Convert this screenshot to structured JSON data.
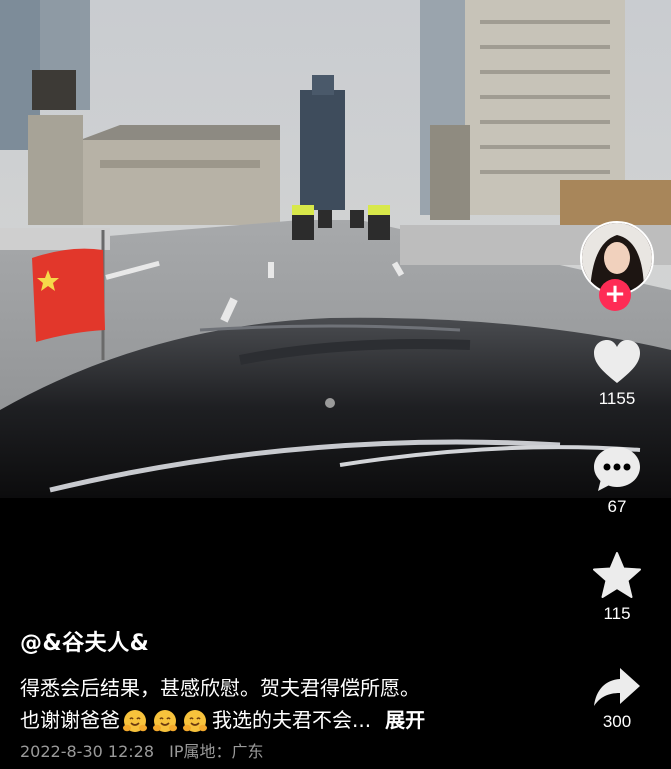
{
  "post": {
    "author": "@&谷夫人&",
    "caption_line1": "得悉会后结果，甚感欣慰。贺夫君得偿所愿。",
    "caption_line2_prefix": "也谢谢爸爸",
    "caption_line2_suffix": "我选的夫君不会...",
    "expand_label": "展开",
    "date": "2022-8-30 12:28",
    "ip_location": "IP属地：广东",
    "emoji_icons": [
      "hugging-face-emoji",
      "hugging-face-emoji",
      "hugging-face-emoji"
    ]
  },
  "actions": {
    "likes": "1155",
    "comments": "67",
    "favorites": "115",
    "shares": "300"
  },
  "theme": {
    "follow_color": "#fe2c55",
    "background": "#000000",
    "meta_text": "#9a9a9a"
  }
}
